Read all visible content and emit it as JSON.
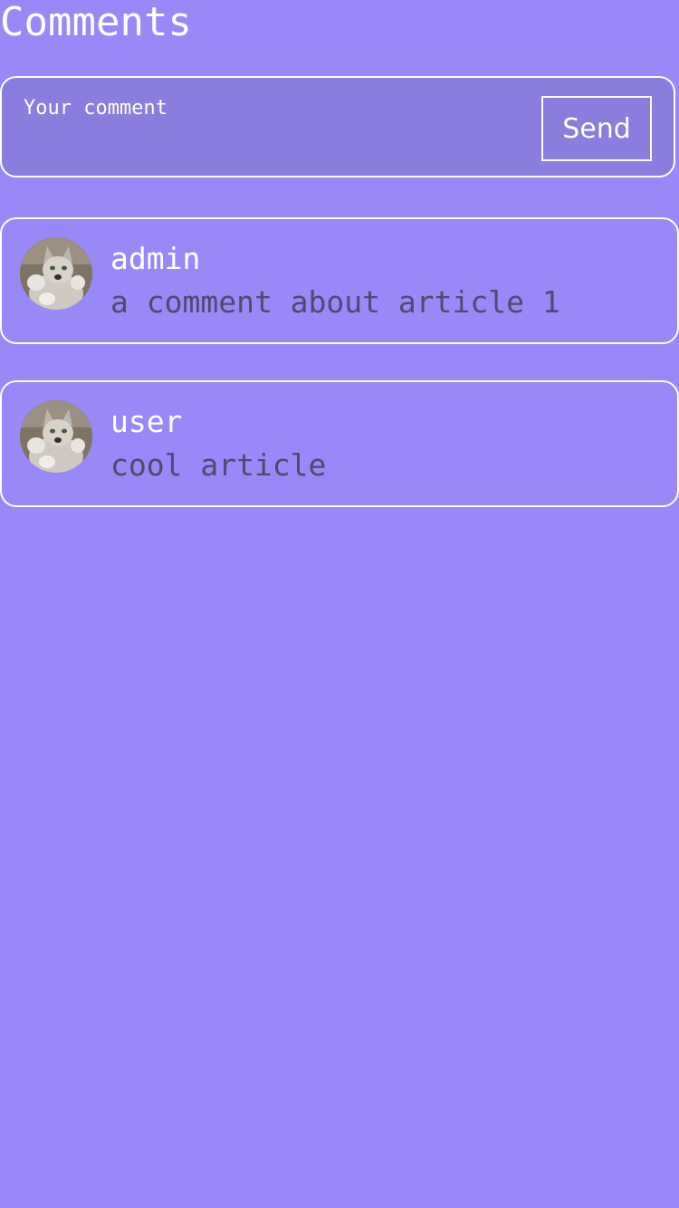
{
  "header": {
    "title": "Comments"
  },
  "composer": {
    "placeholder": "Your comment",
    "value": "",
    "send_label": "Send"
  },
  "comments": [
    {
      "author": "admin",
      "text": "a comment about article 1",
      "avatar_icon": "cat-avatar"
    },
    {
      "author": "user",
      "text": "cool article",
      "avatar_icon": "cat-avatar"
    }
  ],
  "colors": {
    "background": "#9988f8",
    "composer_background": "#897ddd",
    "border": "#ffffff",
    "author_text": "#ffffff",
    "comment_text": "#4e4b6f"
  }
}
